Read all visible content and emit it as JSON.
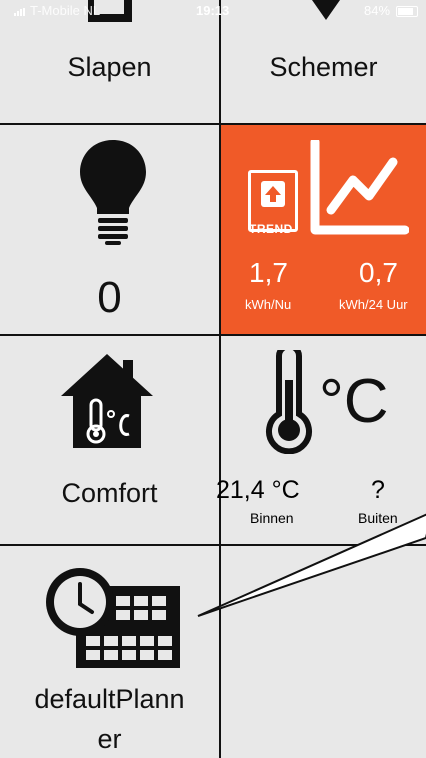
{
  "status_bar": {
    "carrier": "T-Mobile NL",
    "time": "19:13",
    "battery": "84%"
  },
  "tiles": {
    "sleep_label": "Slapen",
    "dim_label": "Schemer",
    "lights_count": "0",
    "comfort_label": "Comfort",
    "planner_label_line1": "defaultPlann",
    "planner_label_line2": "er"
  },
  "energy": {
    "trend_label": "TREND",
    "now_value": "1,7",
    "now_unit": "kWh/Nu",
    "day_value": "0,7",
    "day_unit": "kWh/24 Uur",
    "tile_color": "#f05a28"
  },
  "temperature": {
    "inside_value": "21,4 °C",
    "inside_label": "Binnen",
    "outside_value": "?",
    "outside_label": "Buiten",
    "unit_symbol": "°C"
  },
  "icons": {
    "bulb": "lightbulb-icon",
    "comfort": "house-thermometer-icon",
    "thermometer": "thermometer-icon",
    "planner": "clock-calendar-icon",
    "trend": "trend-chart-icon"
  }
}
